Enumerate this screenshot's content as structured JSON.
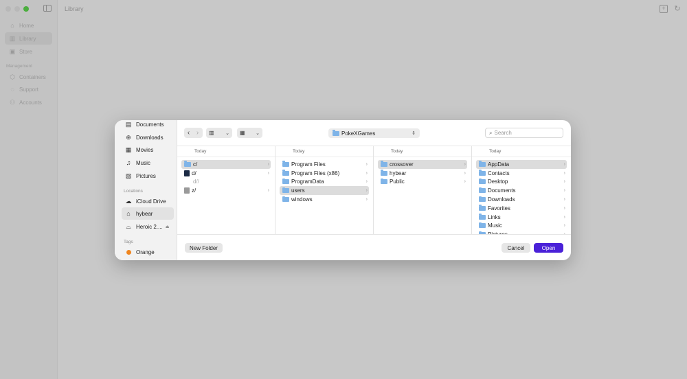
{
  "app": {
    "title": "Library",
    "nav": [
      {
        "label": "Home",
        "icon": "house"
      },
      {
        "label": "Library",
        "icon": "books"
      },
      {
        "label": "Store",
        "icon": "store"
      }
    ],
    "management_label": "Management",
    "management": [
      {
        "label": "Containers",
        "icon": "cube"
      },
      {
        "label": "Support",
        "icon": "chat"
      },
      {
        "label": "Accounts",
        "icon": "people"
      }
    ]
  },
  "dialog": {
    "sidebar": {
      "favorites": [
        {
          "label": "Documents",
          "icon": "doc"
        },
        {
          "label": "Downloads",
          "icon": "download"
        },
        {
          "label": "Movies",
          "icon": "film"
        },
        {
          "label": "Music",
          "icon": "note"
        },
        {
          "label": "Pictures",
          "icon": "picture"
        }
      ],
      "locations_label": "Locations",
      "locations": [
        {
          "label": "iCloud Drive",
          "icon": "cloud"
        },
        {
          "label": "hybear",
          "icon": "house"
        },
        {
          "label": "Heroic 2....",
          "icon": "disk"
        }
      ],
      "tags_label": "Tags",
      "tags": [
        {
          "label": "Orange",
          "color": "#f0851e"
        }
      ]
    },
    "toolbar": {
      "path": "PokeXGames",
      "search_placeholder": "Search"
    },
    "columns": [
      {
        "header": "Today",
        "items": [
          {
            "label": "c/",
            "kind": "folder",
            "arrow": true,
            "selected": true
          },
          {
            "label": "d/",
            "kind": "app",
            "arrow": true
          },
          {
            "label": "d//",
            "kind": "blank",
            "arrow": false,
            "dim": true
          },
          {
            "label": "z/",
            "kind": "drive",
            "arrow": true
          }
        ]
      },
      {
        "header": "Today",
        "items": [
          {
            "label": "Program Files",
            "kind": "folder",
            "arrow": true
          },
          {
            "label": "Program Files (x86)",
            "kind": "folder",
            "arrow": true
          },
          {
            "label": "ProgramData",
            "kind": "folder",
            "arrow": true
          },
          {
            "label": "users",
            "kind": "folder",
            "arrow": true,
            "selected": true
          },
          {
            "label": "windows",
            "kind": "folder",
            "arrow": true
          }
        ]
      },
      {
        "header": "Today",
        "items": [
          {
            "label": "crossover",
            "kind": "folder",
            "arrow": true,
            "selected": true
          },
          {
            "label": "hybear",
            "kind": "folder",
            "arrow": true
          },
          {
            "label": "Public",
            "kind": "folder",
            "arrow": true
          }
        ]
      },
      {
        "header": "Today",
        "items": [
          {
            "label": "AppData",
            "kind": "folder",
            "arrow": true,
            "selected": true
          },
          {
            "label": "Contacts",
            "kind": "folder",
            "arrow": true
          },
          {
            "label": "Desktop",
            "kind": "folder",
            "arrow": true
          },
          {
            "label": "Documents",
            "kind": "folder",
            "arrow": true
          },
          {
            "label": "Downloads",
            "kind": "folder",
            "arrow": true
          },
          {
            "label": "Favorites",
            "kind": "folder",
            "arrow": true
          },
          {
            "label": "Links",
            "kind": "folder",
            "arrow": true
          },
          {
            "label": "Music",
            "kind": "folder",
            "arrow": true
          },
          {
            "label": "Pictures",
            "kind": "folder",
            "arrow": true
          }
        ]
      }
    ],
    "footer": {
      "new_folder": "New Folder",
      "cancel": "Cancel",
      "open": "Open"
    }
  }
}
